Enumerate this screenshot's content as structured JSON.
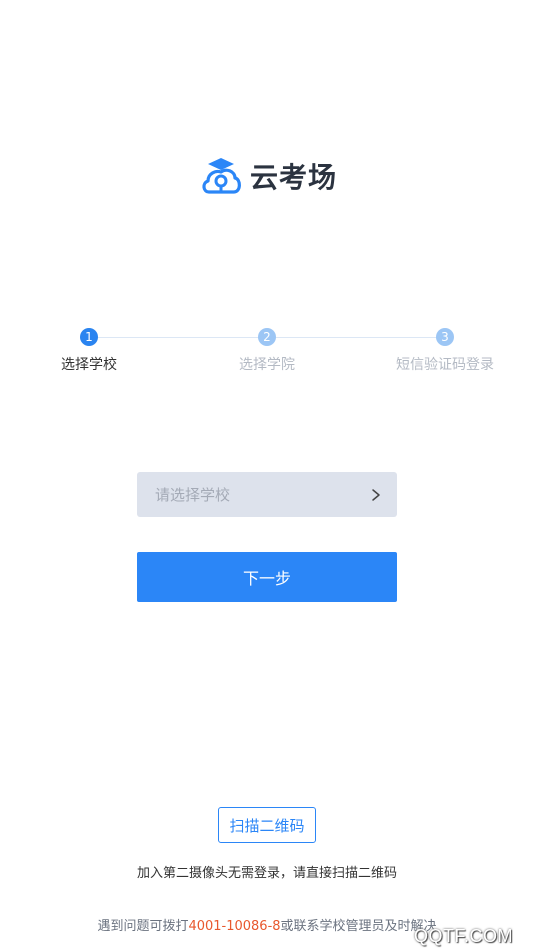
{
  "app": {
    "name": "云考场"
  },
  "steps": [
    {
      "number": "1",
      "label": "选择学校",
      "state": "active"
    },
    {
      "number": "2",
      "label": "选择学院",
      "state": "inactive"
    },
    {
      "number": "3",
      "label": "短信验证码登录",
      "state": "inactive"
    }
  ],
  "school_select": {
    "placeholder": "请选择学校",
    "icon": "chevron-right-icon"
  },
  "next_button": {
    "label": "下一步"
  },
  "scan_button": {
    "label": "扫描二维码"
  },
  "hint": {
    "text": "加入第二摄像头无需登录，请直接扫描二维码"
  },
  "help": {
    "prefix": "遇到问题可拨打",
    "phone": "4001-10086-8",
    "suffix": "或联系学校管理员及时解决"
  },
  "watermark": {
    "text": "QQTF.COM"
  },
  "colors": {
    "primary": "#2b86f7",
    "step_active": "#2a84f0",
    "step_inactive": "#9cc6f5",
    "phone_highlight": "#e8582e",
    "select_bg": "#dde2ec"
  }
}
